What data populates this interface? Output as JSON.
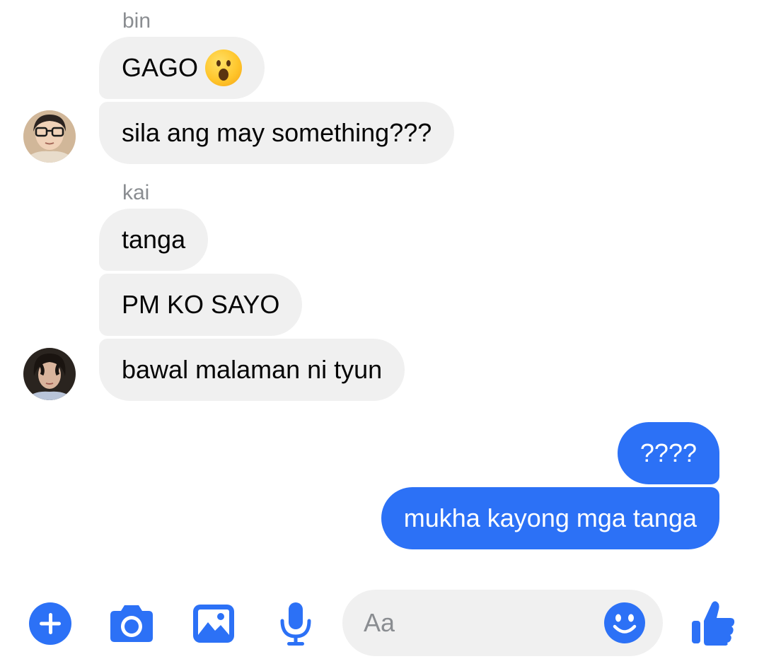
{
  "accent_color": "#2c71f6",
  "incoming_bubble_color": "#f0f0f0",
  "thread": {
    "groups": [
      {
        "sender": "bin",
        "avatar": "avatar-bin",
        "messages": [
          {
            "text": "GAGO",
            "emoji": "astonished-face-emoji"
          },
          {
            "text": "sila ang may something???"
          }
        ]
      },
      {
        "sender": "kai",
        "avatar": "avatar-kai",
        "messages": [
          {
            "text": "tanga"
          },
          {
            "text": "PM KO SAYO"
          },
          {
            "text": "bawal malaman ni tyun"
          }
        ]
      }
    ],
    "outgoing": [
      {
        "text": "????"
      },
      {
        "text": "mukha kayong mga tanga"
      }
    ]
  },
  "composer": {
    "placeholder": "Aa",
    "value": "",
    "icons": [
      "plus-icon",
      "camera-icon",
      "gallery-icon",
      "microphone-icon",
      "emoji-icon",
      "thumbs-up-icon"
    ]
  }
}
